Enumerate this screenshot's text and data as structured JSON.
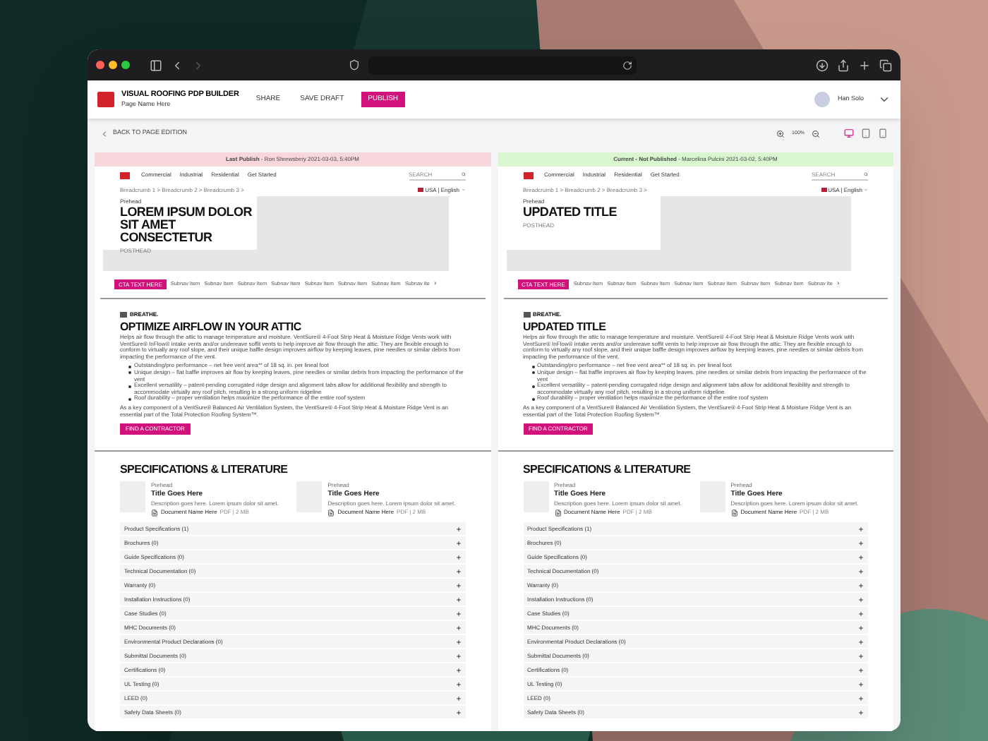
{
  "app_header": {
    "title": "VISUAL ROOFING PDP BUILDER",
    "subtitle": "Page Name Here",
    "actions": [
      {
        "label": "SHARE",
        "kind": "link"
      },
      {
        "label": "SAVE DRAFT",
        "kind": "link"
      },
      {
        "label": "PUBLISH",
        "kind": "primary"
      }
    ],
    "user": "Han Solo"
  },
  "toolbar": {
    "back": "BACK TO PAGE EDITION",
    "zoom": "100%",
    "devices": [
      {
        "kind": "desktop",
        "selected": true
      },
      {
        "kind": "tablet",
        "selected": false
      },
      {
        "kind": "phone",
        "selected": false
      }
    ]
  },
  "panels": [
    {
      "banner": {
        "kind": "published",
        "text": "**Last Publish** - Ron Shrewsbery 2021-03-03, 5:40PM"
      },
      "site_nav": [
        "Commercial",
        "Industrial",
        "Residential",
        "Get Started"
      ],
      "search": {
        "placeholder": "SEARCH"
      },
      "breadcrumb": "Breadcrumb 1 > Breadcrumb 2 > Breadcrumb 3 >",
      "language": "USA | English",
      "hero": {
        "prehead": "Prehead",
        "title": "LOREM IPSUM DOLOR SIT AMET CONSECTETUR",
        "posthead": "POSTHEAD"
      },
      "cta": "CTA TEXT HERE",
      "subnav": [
        "Subnav Item",
        "Subnav Item",
        "Subnav Item",
        "Subnav Item",
        "Subnav Item",
        "Subnav Item",
        "Subnav Item",
        "Subnav Ite"
      ],
      "subnav_more": "›",
      "feature": {
        "brand": "BREATHE.",
        "title": "OPTIMIZE AIRFLOW IN YOUR ATTIC",
        "intro": "Helps air flow through the attic to manage temperature and moisture. VentSure® 4-Foot Strip Heat & Moisture Ridge Vents work with VentSure® InFlow® intake vents and/or undereave soffit vents to help improve air flow through the attic. They are flexible enough to conform to virtually any roof slope, and their unique baffle design improves airflow by keeping leaves, pine needles or similar debris from impacting the performance of the vent.",
        "bullets": [
          "Outstanding/pro performance – net free vent area** of 18 sq. in. per lineal foot",
          "Unique design – flat baffle improves air flow by keeping leaves, pine needles or similar debris from impacting the performance of the vent",
          "Excellent versatility – patent-pending corrugated ridge design and alignment tabs allow for additional flexibility and strength to accommodate virtually any roof pitch, resulting in a strong uniform ridgeline",
          "Roof durability – proper ventilation helps maximize the performance of the entire roof system"
        ],
        "closing": "As a key component of a VentSure® Balanced Air Ventilation System, the VentSure® 4-Foot Strip Heat & Moisture Ridge Vent is an essential part of the Total Protection Roofing System™.",
        "button": "FIND A CONTRACTOR"
      },
      "specs": {
        "title": "SPECIFICATIONS & LITERATURE",
        "documents": [
          {
            "prehead": "Prehead",
            "title": "Title Goes Here",
            "description": "Description goes here. Lorem ipsum dolor sit amet.",
            "file": "Document Name Here",
            "meta": "PDF | 2 MB"
          },
          {
            "prehead": "Prehead",
            "title": "Title Goes Here",
            "description": "Description goes here. Lorem ipsum dolor sit amet.",
            "file": "Document Name Here",
            "meta": "PDF | 2 MB"
          }
        ],
        "sections": [
          "Product Specifications (1)",
          "Brochures (0)",
          "Guide Specifications (0)",
          "Technical Documentation (0)",
          "Warranty (0)",
          "Installation Instructions (0)",
          "Case Studies (0)",
          "MHC Documents (0)",
          "Environmental Product Declarations (0)",
          "Submittal Documents (0)",
          "Certifications (0)",
          "UL Testing (0)",
          "LEED (0)",
          "Safety Data Sheets (0)"
        ]
      }
    },
    {
      "banner": {
        "kind": "draft",
        "text": "**Current - Not Published** - Marcelina Pulcini 2021-03-02, 5:40PM"
      },
      "site_nav": [
        "Commercial",
        "Industrial",
        "Residential",
        "Get Started"
      ],
      "search": {
        "placeholder": "SEARCH"
      },
      "breadcrumb": "Breadcrumb 1 > Breadcrumb 2 > Breadcrumb 3 >",
      "language": "USA | English",
      "hero": {
        "prehead": "Prehead",
        "title": "UPDATED TITLE",
        "posthead": "POSTHEAD"
      },
      "cta": "CTA TEXT HERE",
      "subnav": [
        "Subnav Item",
        "Subnav Item",
        "Subnav Item",
        "Subnav Item",
        "Subnav Item",
        "Subnav Item",
        "Subnav Item",
        "Subnav Ite"
      ],
      "subnav_more": "›",
      "feature": {
        "brand": "BREATHE.",
        "title": "UPDATED TITLE",
        "intro": "Helps air flow through the attic to manage temperature and moisture. VentSure® 4-Foot Strip Heat & Moisture Ridge Vents work with VentSure® InFlow® intake vents and/or undereave soffit vents to help improve air flow through the attic. They are flexible enough to conform to virtually any roof slope, and their unique baffle design improves airflow by keeping leaves, pine needles or similar debris from impacting the performance of the vent.",
        "bullets": [
          "Outstanding/pro performance – net free vent area** of 18 sq. in. per lineal foot",
          "Unique design – flat baffle improves air flow by keeping leaves, pine needles or similar debris from impacting the performance of the vent",
          "Excellent versatility – patent-pending corrugated ridge design and alignment tabs allow for additional flexibility and strength to accommodate virtually any roof pitch, resulting in a strong uniform ridgeline",
          "Roof durability – proper ventilation helps maximize the performance of the entire roof system"
        ],
        "closing": "As a key component of a VentSure® Balanced Air Ventilation System, the VentSure® 4-Foot Strip Heat & Moisture Ridge Vent is an essential part of the Total Protection Roofing System™.",
        "button": "FIND A CONTRACTOR"
      },
      "specs": {
        "title": "SPECIFICATIONS & LITERATURE",
        "documents": [
          {
            "prehead": "Prehead",
            "title": "Title Goes Here",
            "description": "Description goes here. Lorem ipsum dolor sit amet.",
            "file": "Document Name Here",
            "meta": "PDF | 2 MB"
          },
          {
            "prehead": "Prehead",
            "title": "Title Goes Here",
            "description": "Description goes here. Lorem ipsum dolor sit amet.",
            "file": "Document Name Here",
            "meta": "PDF | 2 MB"
          }
        ],
        "sections": [
          "Product Specifications (1)",
          "Brochures (0)",
          "Guide Specifications (0)",
          "Technical Documentation (0)",
          "Warranty (0)",
          "Installation Instructions (0)",
          "Case Studies (0)",
          "MHC Documents (0)",
          "Environmental Product Declarations (0)",
          "Submittal Documents (0)",
          "Certifications (0)",
          "UL Testing (0)",
          "LEED (0)",
          "Safety Data Sheets (0)"
        ]
      }
    }
  ]
}
